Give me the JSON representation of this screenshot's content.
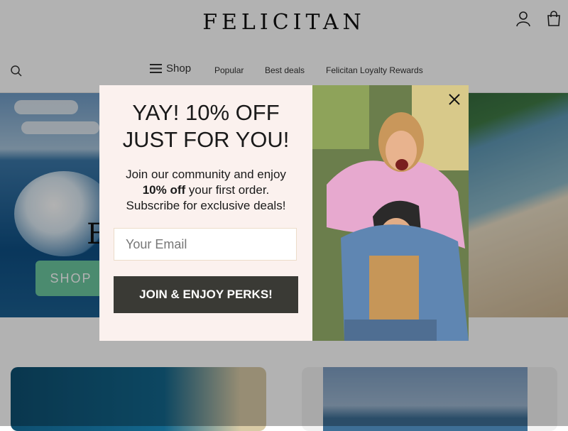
{
  "header": {
    "logo": "Felicitan",
    "account_icon": "user-icon",
    "cart_icon": "shopping-bag-icon"
  },
  "nav": {
    "search_icon": "search-icon",
    "menu_icon": "hamburger-icon",
    "shop": "Shop",
    "items": [
      "Popular",
      "Best deals",
      "Felicitan Loyalty Rewards"
    ]
  },
  "hero": {
    "button": "SHOP",
    "letter": "E"
  },
  "popup": {
    "headline_line1": "YAY! 10% OFF",
    "headline_line2": "JUST FOR YOU!",
    "body_line1": "Join our community and enjoy",
    "body_bold": "10% off",
    "body_line2_rest": " your first order.",
    "body_line3": "Subscribe for exclusive deals!",
    "email_placeholder": "Your Email",
    "cta": "JOIN & ENJOY PERKS!",
    "close_icon": "close-icon",
    "colors": {
      "background": "#fbf1ee",
      "cta_bg": "#3a3a35",
      "cta_text": "#ffffff"
    }
  }
}
